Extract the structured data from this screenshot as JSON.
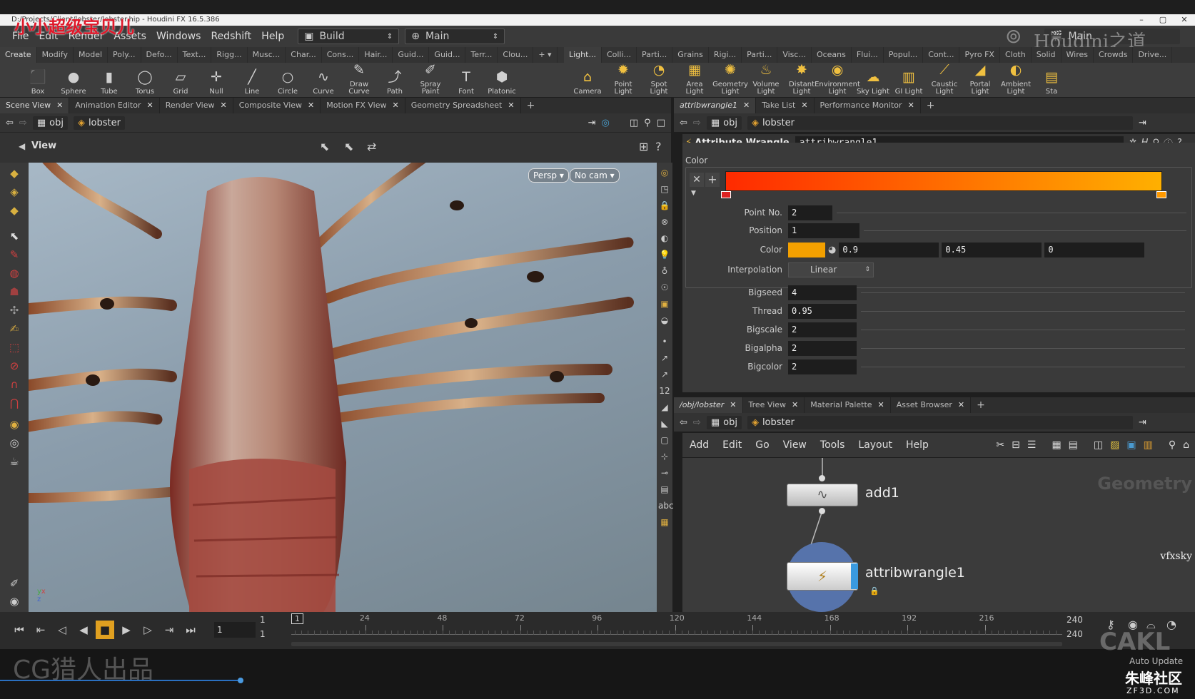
{
  "window_title": "D:/Projects/Client/lobster/lobster.hip - Houdini FX 16.5.386",
  "watermarks": {
    "top": "小小超级宝贝儿",
    "bottom_left": "CG猎人出品",
    "houdini": "Houdini之道",
    "geometry": "Geometry",
    "vfxsky": "vfxsky",
    "cakl": "CAKL",
    "zf3d": "朱峰社区",
    "zf3d_url": "ZF3D.COM"
  },
  "menu": [
    "File",
    "Edit",
    "Render",
    "Assets",
    "Windows",
    "Redshift",
    "Help"
  ],
  "desktop": {
    "build": "Build",
    "main": "Main",
    "main_right": "Main"
  },
  "shelf_tabs_left": [
    "Create",
    "Modify",
    "Model",
    "Poly...",
    "Defo...",
    "Text...",
    "Rigg...",
    "Musc...",
    "Char...",
    "Cons...",
    "Hair...",
    "Guid...",
    "Guid...",
    "Terr...",
    "Clou..."
  ],
  "shelf_tabs_right": [
    "Light...",
    "Colli...",
    "Parti...",
    "Grains",
    "Rigi...",
    "Parti...",
    "Visc...",
    "Oceans",
    "Flui...",
    "Popul...",
    "Cont...",
    "Pyro FX",
    "Cloth",
    "Solid",
    "Wires",
    "Crowds",
    "Drive..."
  ],
  "tools_left": [
    {
      "label": "Box",
      "icon": "box-icon",
      "glyph": "⬛"
    },
    {
      "label": "Sphere",
      "icon": "sphere-icon",
      "glyph": "●"
    },
    {
      "label": "Tube",
      "icon": "tube-icon",
      "glyph": "▮"
    },
    {
      "label": "Torus",
      "icon": "torus-icon",
      "glyph": "◯"
    },
    {
      "label": "Grid",
      "icon": "grid-icon",
      "glyph": "▱"
    },
    {
      "label": "Null",
      "icon": "null-icon",
      "glyph": "✛"
    },
    {
      "label": "Line",
      "icon": "line-icon",
      "glyph": "╱"
    },
    {
      "label": "Circle",
      "icon": "circle-icon",
      "glyph": "○"
    },
    {
      "label": "Curve",
      "icon": "curve-icon",
      "glyph": "∿"
    },
    {
      "label": "Draw Curve",
      "icon": "draw-curve-icon",
      "glyph": "✎"
    },
    {
      "label": "Path",
      "icon": "path-icon",
      "glyph": "⤴"
    },
    {
      "label": "Spray Paint",
      "icon": "spray-paint-icon",
      "glyph": "✐"
    },
    {
      "label": "Font",
      "icon": "font-icon",
      "glyph": "T"
    },
    {
      "label": "Platonic",
      "icon": "platonic-icon",
      "glyph": "⬢"
    }
  ],
  "tools_right": [
    {
      "label": "Camera",
      "icon": "camera-icon",
      "glyph": "⌂"
    },
    {
      "label": "Point Light",
      "icon": "point-light-icon",
      "glyph": "✹"
    },
    {
      "label": "Spot Light",
      "icon": "spot-light-icon",
      "glyph": "◔"
    },
    {
      "label": "Area Light",
      "icon": "area-light-icon",
      "glyph": "▦"
    },
    {
      "label": "Geometry Light",
      "icon": "geometry-light-icon",
      "glyph": "✺"
    },
    {
      "label": "Volume Light",
      "icon": "volume-light-icon",
      "glyph": "♨"
    },
    {
      "label": "Distant Light",
      "icon": "distant-light-icon",
      "glyph": "✸"
    },
    {
      "label": "Environment Light",
      "icon": "environment-light-icon",
      "glyph": "◉"
    },
    {
      "label": "Sky Light",
      "icon": "sky-light-icon",
      "glyph": "☁"
    },
    {
      "label": "GI Light",
      "icon": "gi-light-icon",
      "glyph": "▥"
    },
    {
      "label": "Caustic Light",
      "icon": "caustic-light-icon",
      "glyph": "⟋"
    },
    {
      "label": "Portal Light",
      "icon": "portal-light-icon",
      "glyph": "◢"
    },
    {
      "label": "Ambient Light",
      "icon": "ambient-light-icon",
      "glyph": "◐"
    },
    {
      "label": "Sta",
      "icon": "stage-icon",
      "glyph": "▤"
    }
  ],
  "left_tabs": [
    "Scene View",
    "Animation Editor",
    "Render View",
    "Composite View",
    "Motion FX View",
    "Geometry Spreadsheet"
  ],
  "right_top_tabs": [
    "attribwrangle1",
    "Take List",
    "Performance Monitor"
  ],
  "right_bottom_tabs": [
    "/obj/lobster",
    "Tree View",
    "Material Palette",
    "Asset Browser"
  ],
  "path": {
    "obj": "obj",
    "node": "lobster"
  },
  "viewport": {
    "label": "View",
    "persp": "Persp",
    "cam": "No cam"
  },
  "params": {
    "node_type": "Attribute Wrangle",
    "node_name": "attribwrangle1",
    "section": "Color",
    "point_no_label": "Point No.",
    "point_no": "2",
    "position_label": "Position",
    "position": "1",
    "color_label": "Color",
    "color_r": "0.9",
    "color_g": "0.45",
    "color_b": "0",
    "color_hex": "#f3a000",
    "interp_label": "Interpolation",
    "interp": "Linear",
    "bigseed_label": "Bigseed",
    "bigseed": "4",
    "thread_label": "Thread",
    "thread": "0.95",
    "bigscale_label": "Bigscale",
    "bigscale": "2",
    "bigalpha_label": "Bigalpha",
    "bigalpha": "2",
    "bigcolor_label": "Bigcolor",
    "bigcolor": "2"
  },
  "net_menu": [
    "Add",
    "Edit",
    "Go",
    "View",
    "Tools",
    "Layout",
    "Help"
  ],
  "nodes": {
    "add": "add1",
    "wrangle": "attribwrangle1"
  },
  "timeline": {
    "frame": "1",
    "start": "1",
    "range_start": "1",
    "end": "240",
    "end2": "240",
    "ticks": [
      "24",
      "48",
      "72",
      "96",
      "120",
      "144",
      "168",
      "192",
      "216"
    ],
    "auto_update": "Auto Update"
  },
  "colors": {
    "accent": "#f3a000",
    "ramp_start": "#ff2a00",
    "ramp_end": "#ffb000"
  }
}
